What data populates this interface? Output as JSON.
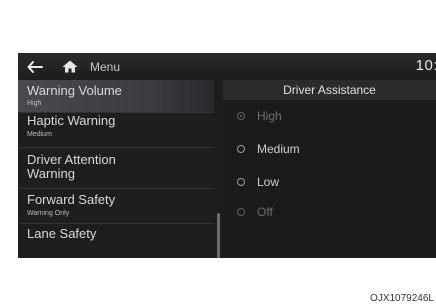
{
  "topbar": {
    "back_icon": "back-arrow-icon",
    "home_icon": "home-icon",
    "menu_label": "Menu",
    "clock": "10:"
  },
  "section_title": "Driver Assistance",
  "menu_items": [
    {
      "title": "Warning Volume",
      "subtitle": "High",
      "active": true
    },
    {
      "title": "Haptic Warning",
      "subtitle": "Medium",
      "active": false
    },
    {
      "title": "Driver Attention Warning",
      "subtitle": "",
      "active": false
    },
    {
      "title": "Forward Safety",
      "subtitle": "Warning Only",
      "active": false
    },
    {
      "title": "Lane Safety",
      "subtitle": "",
      "active": false
    }
  ],
  "options": [
    {
      "label": "High",
      "selected": true,
      "enabled": false
    },
    {
      "label": "Medium",
      "selected": false,
      "enabled": true
    },
    {
      "label": "Low",
      "selected": false,
      "enabled": true
    },
    {
      "label": "Off",
      "selected": false,
      "enabled": false
    }
  ],
  "caption": "OJX1079246L",
  "colors": {
    "background": "#1c1c1e",
    "active_row": "#4a4a4e",
    "text": "#d8d8d8"
  }
}
